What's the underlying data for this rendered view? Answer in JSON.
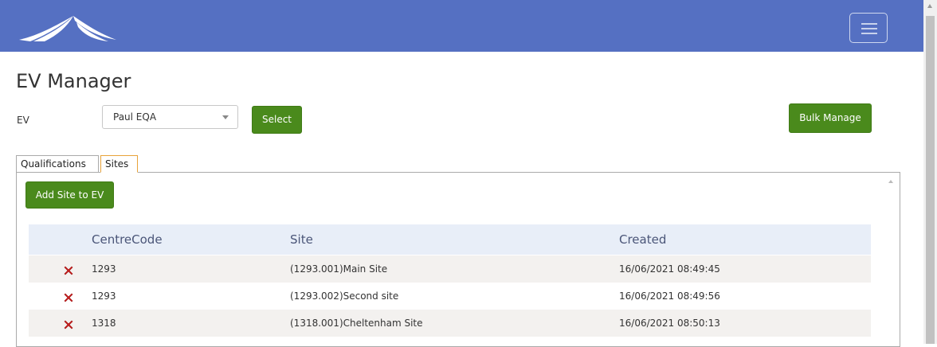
{
  "page_title": "EV Manager",
  "ev_filter": {
    "label": "EV",
    "selected": "Paul EQA",
    "select_button": "Select"
  },
  "bulk_manage_button": "Bulk Manage",
  "tabs": [
    {
      "label": "Qualifications",
      "active": false
    },
    {
      "label": "Sites",
      "active": true
    }
  ],
  "add_site_button": "Add Site to EV",
  "table": {
    "headers": [
      "CentreCode",
      "Site",
      "Created"
    ],
    "rows": [
      {
        "centre_code": "1293",
        "site": "(1293.001)Main Site",
        "created": "16/06/2021 08:49:45"
      },
      {
        "centre_code": "1293",
        "site": "(1293.002)Second site",
        "created": "16/06/2021 08:49:56"
      },
      {
        "centre_code": "1318",
        "site": "(1318.001)Cheltenham Site",
        "created": "16/06/2021 08:50:13"
      }
    ]
  },
  "colors": {
    "navbar": "#5570c2",
    "button_green": "#4a8a1c",
    "active_tab_border": "#e8a33a",
    "delete_red": "#d11f1f"
  },
  "icons": [
    "mountain-logo-icon",
    "hamburger-menu-icon",
    "delete-x-icon",
    "dropdown-caret-icon"
  ]
}
